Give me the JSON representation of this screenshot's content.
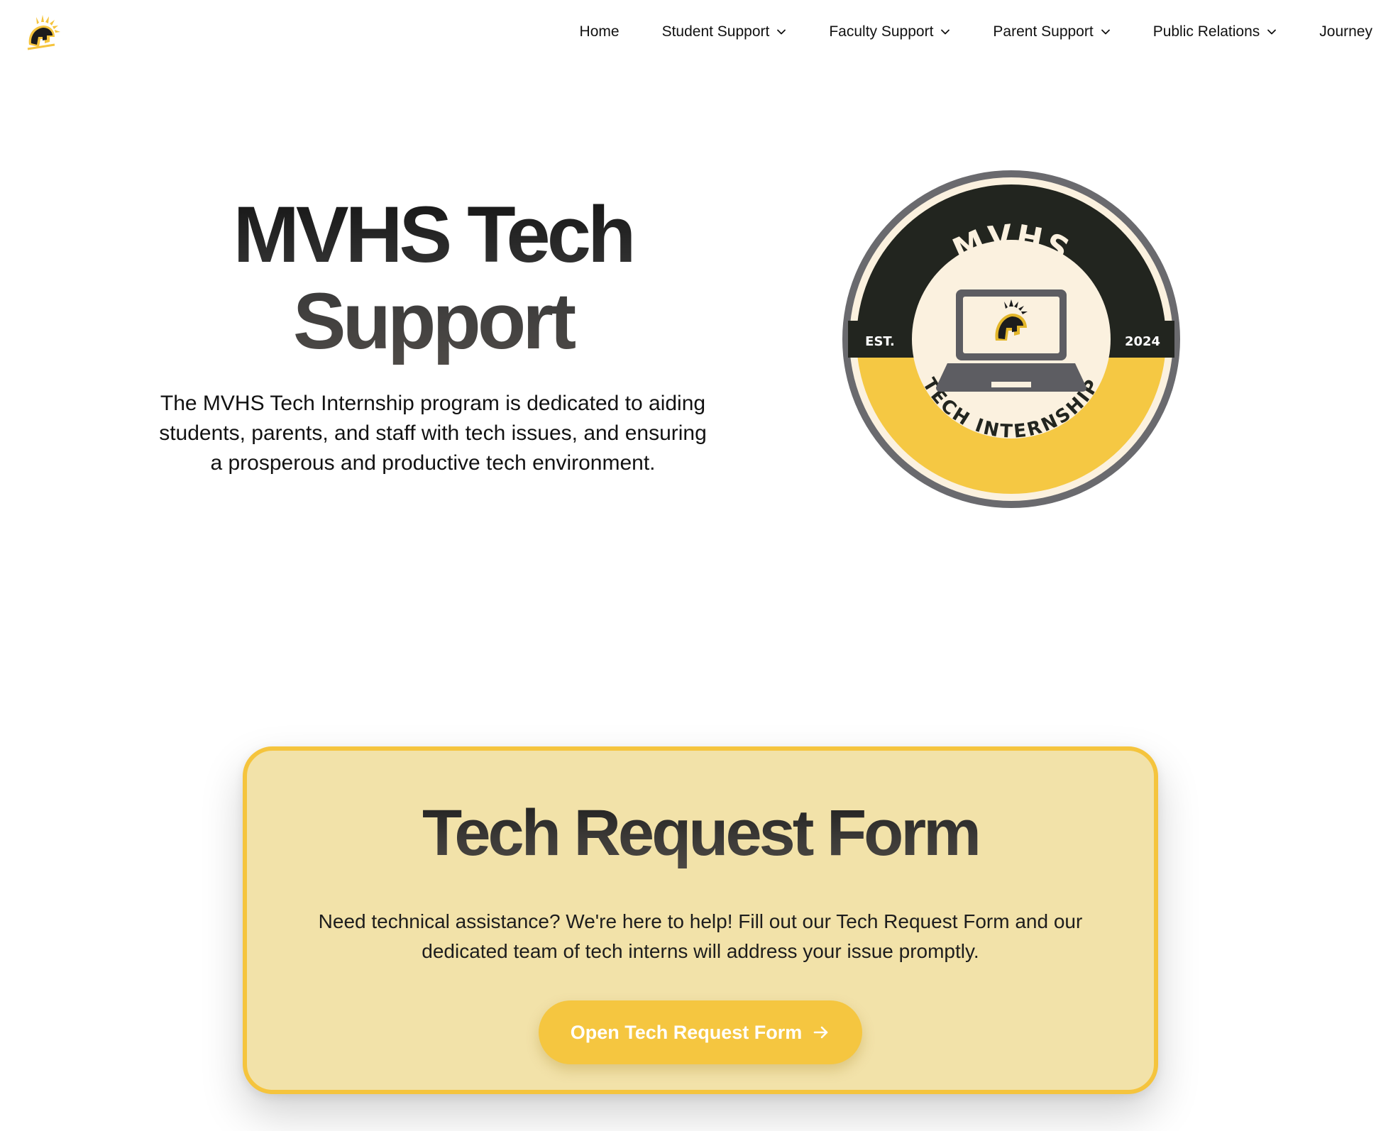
{
  "nav": {
    "logo_icon": "spartan-helmet-icon",
    "items": [
      {
        "label": "Home",
        "dropdown": false
      },
      {
        "label": "Student Support",
        "dropdown": true
      },
      {
        "label": "Faculty Support",
        "dropdown": true
      },
      {
        "label": "Parent Support",
        "dropdown": true
      },
      {
        "label": "Public Relations",
        "dropdown": true
      },
      {
        "label": "Journey",
        "dropdown": false
      }
    ]
  },
  "hero": {
    "title_line1": "MVHS Tech",
    "title_line2": "Support",
    "description": "The MVHS Tech Internship program is dedicated to aiding students, parents, and staff with tech issues, and ensuring a prosperous and productive tech environment."
  },
  "badge": {
    "top_text": "MVHS",
    "left_text": "EST.",
    "right_text": "2024",
    "bottom_text": "TECH INTERNSHIP",
    "icon": "laptop-helmet-icon"
  },
  "form_card": {
    "title": "Tech Request Form",
    "description": "Need technical assistance? We're here to help! Fill out our Tech Request Form and our dedicated team of tech interns will address your issue promptly.",
    "button_label": "Open Tech Request Form",
    "button_icon": "arrow-right-icon"
  },
  "colors": {
    "accent_yellow": "#f5c640",
    "card_background": "#f2e2a9",
    "badge_dark": "#22251f",
    "badge_ring": "#6a6a6e",
    "badge_cream": "#fbf1df"
  }
}
